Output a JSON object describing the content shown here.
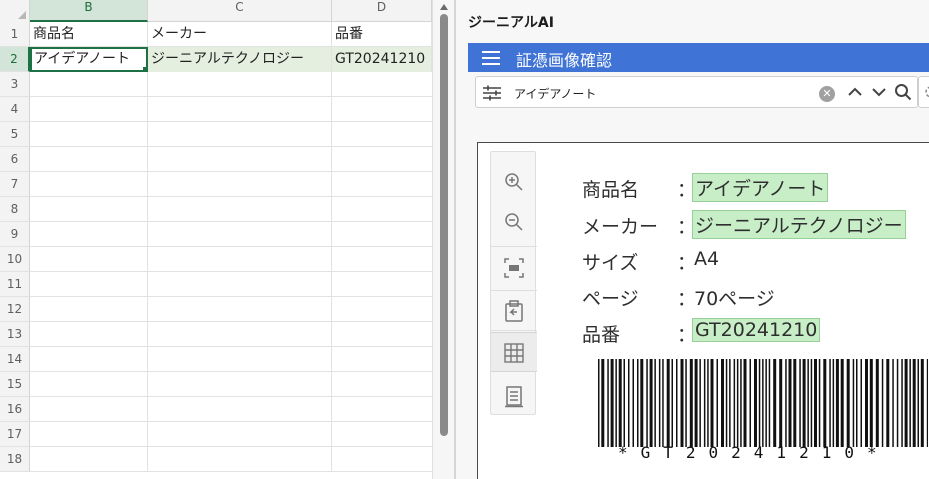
{
  "sheet": {
    "columns": [
      {
        "letter": "B",
        "selected": true
      },
      {
        "letter": "C",
        "selected": false
      },
      {
        "letter": "D",
        "selected": false
      }
    ],
    "row_numbers": [
      "1",
      "2",
      "3",
      "4",
      "5",
      "6",
      "7",
      "8",
      "9",
      "10",
      "11",
      "12",
      "13",
      "14",
      "15",
      "16",
      "17",
      "18"
    ],
    "header_row": [
      "商品名",
      "メーカー",
      "品番"
    ],
    "data_row": [
      "アイデアノート",
      "ジーニアルテクノロジー",
      "GT20241210"
    ]
  },
  "panel": {
    "title": "ジーニアルAI",
    "bar_title": "証憑画像確認",
    "search_value": "アイデアノート",
    "clear_glyph": "✕"
  },
  "document": {
    "rows": [
      {
        "label": "商品名",
        "colon": "：",
        "value": "アイデアノート",
        "highlighted": true
      },
      {
        "label": "メーカー",
        "colon": "：",
        "value": "ジーニアルテクノロジー",
        "highlighted": true
      },
      {
        "label": "サイズ",
        "colon": "：",
        "value": "A4",
        "highlighted": false
      },
      {
        "label": "ページ",
        "colon": "：",
        "value": "70ページ",
        "highlighted": false
      },
      {
        "label": "品番",
        "colon": "：",
        "value": "GT20241210",
        "highlighted": true
      }
    ],
    "barcode_text": "*GT20241210*"
  },
  "toolbar": {
    "tools": [
      "zoom-in-icon",
      "zoom-out-icon",
      "fit-screen-icon",
      "clipboard-return-icon",
      "grid-icon",
      "document-icon"
    ]
  },
  "colors": {
    "accent_blue": "#3f74d6",
    "excel_green": "#1e7145",
    "highlight_green": "#c7eec7"
  }
}
